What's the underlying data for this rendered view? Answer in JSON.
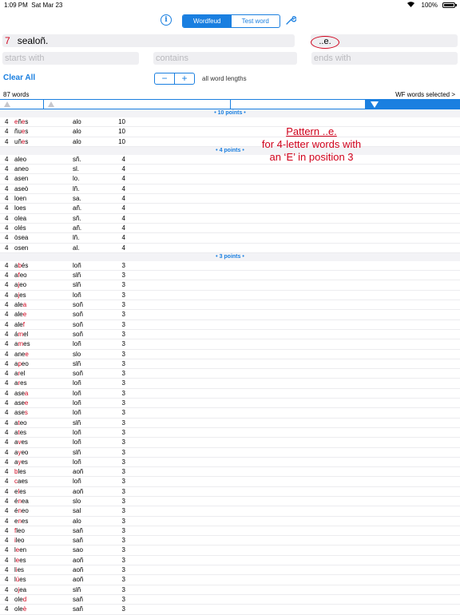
{
  "status": {
    "time": "1:09 PM",
    "date": "Sat Mar 23",
    "battery": "100%"
  },
  "toolbar": {
    "info": "i",
    "segments": [
      "Wordfeud",
      "Test word"
    ],
    "active_segment": 0
  },
  "rack": {
    "count": "7",
    "letters": "sealoñ.",
    "pattern": "..e."
  },
  "filters": {
    "starts_with": "starts with",
    "contains": "contains",
    "ends_with": "ends with"
  },
  "controls": {
    "clear_all": "Clear All",
    "minus": "−",
    "plus": "+",
    "word_lengths": "all word lengths"
  },
  "summary": {
    "count": "87 words",
    "selected": "WF words selected >"
  },
  "annotation": {
    "line1": "Pattern ..e.",
    "line2": "for 4-letter words with",
    "line3": "an ‘E’ in position 3"
  },
  "sections": [
    {
      "label": "• 10 points •",
      "rows": [
        {
          "len": "4",
          "w": [
            [
              "e",
              "h"
            ],
            [
              "ñ",
              ""
            ],
            [
              "e",
              "h"
            ],
            [
              "s",
              ""
            ]
          ],
          "rack": "alo",
          "pts": "10"
        },
        {
          "len": "4",
          "w": [
            [
              "ñ",
              ""
            ],
            [
              "u",
              ""
            ],
            [
              "e",
              "h"
            ],
            [
              "s",
              ""
            ]
          ],
          "rack": "alo",
          "pts": "10"
        },
        {
          "len": "4",
          "w": [
            [
              "u",
              ""
            ],
            [
              "ñ",
              ""
            ],
            [
              "e",
              "h"
            ],
            [
              "s",
              ""
            ]
          ],
          "rack": "alo",
          "pts": "10"
        }
      ]
    },
    {
      "label": "• 4 points •",
      "rows": [
        {
          "len": "4",
          "w": [
            [
              "aleo",
              ""
            ]
          ],
          "rack": "sñ.",
          "pts": "4"
        },
        {
          "len": "4",
          "w": [
            [
              "aneo",
              ""
            ]
          ],
          "rack": "sl.",
          "pts": "4"
        },
        {
          "len": "4",
          "w": [
            [
              "asen",
              ""
            ]
          ],
          "rack": "lo.",
          "pts": "4"
        },
        {
          "len": "4",
          "w": [
            [
              "aseò",
              ""
            ]
          ],
          "rack": "lñ.",
          "pts": "4"
        },
        {
          "len": "4",
          "w": [
            [
              "loen",
              ""
            ]
          ],
          "rack": "sa.",
          "pts": "4"
        },
        {
          "len": "4",
          "w": [
            [
              "loes",
              ""
            ]
          ],
          "rack": "añ.",
          "pts": "4"
        },
        {
          "len": "4",
          "w": [
            [
              "olea",
              ""
            ]
          ],
          "rack": "sñ.",
          "pts": "4"
        },
        {
          "len": "4",
          "w": [
            [
              "olés",
              ""
            ]
          ],
          "rack": "añ.",
          "pts": "4"
        },
        {
          "len": "4",
          "w": [
            [
              "òsea",
              ""
            ]
          ],
          "rack": "lñ.",
          "pts": "4"
        },
        {
          "len": "4",
          "w": [
            [
              "osen",
              ""
            ]
          ],
          "rack": "al.",
          "pts": "4"
        }
      ]
    },
    {
      "label": "• 3 points •",
      "rows": [
        {
          "len": "4",
          "w": [
            [
              "a",
              ""
            ],
            [
              "b",
              "h"
            ],
            [
              "és",
              ""
            ]
          ],
          "rack": "loñ",
          "pts": "3"
        },
        {
          "len": "4",
          "w": [
            [
              "a",
              ""
            ],
            [
              "f",
              "h"
            ],
            [
              "eo",
              ""
            ]
          ],
          "rack": "slñ",
          "pts": "3"
        },
        {
          "len": "4",
          "w": [
            [
              "a",
              ""
            ],
            [
              "j",
              "h"
            ],
            [
              "eo",
              ""
            ]
          ],
          "rack": "slñ",
          "pts": "3"
        },
        {
          "len": "4",
          "w": [
            [
              "a",
              ""
            ],
            [
              "j",
              "h"
            ],
            [
              "es",
              ""
            ]
          ],
          "rack": "loñ",
          "pts": "3"
        },
        {
          "len": "4",
          "w": [
            [
              "ale",
              ""
            ],
            [
              "a",
              "h"
            ]
          ],
          "rack": "soñ",
          "pts": "3"
        },
        {
          "len": "4",
          "w": [
            [
              "ale",
              ""
            ],
            [
              "e",
              "h"
            ]
          ],
          "rack": "soñ",
          "pts": "3"
        },
        {
          "len": "4",
          "w": [
            [
              "ale",
              ""
            ],
            [
              "f",
              "h"
            ]
          ],
          "rack": "soñ",
          "pts": "3"
        },
        {
          "len": "4",
          "w": [
            [
              "á",
              ""
            ],
            [
              "m",
              "h"
            ],
            [
              "el",
              ""
            ]
          ],
          "rack": "soñ",
          "pts": "3"
        },
        {
          "len": "4",
          "w": [
            [
              "a",
              ""
            ],
            [
              "m",
              "h"
            ],
            [
              "es",
              ""
            ]
          ],
          "rack": "loñ",
          "pts": "3"
        },
        {
          "len": "4",
          "w": [
            [
              "ane",
              ""
            ],
            [
              "e",
              "h"
            ]
          ],
          "rack": "slo",
          "pts": "3"
        },
        {
          "len": "4",
          "w": [
            [
              "a",
              ""
            ],
            [
              "p",
              "h"
            ],
            [
              "eo",
              ""
            ]
          ],
          "rack": "slñ",
          "pts": "3"
        },
        {
          "len": "4",
          "w": [
            [
              "a",
              ""
            ],
            [
              "r",
              "h"
            ],
            [
              "el",
              ""
            ]
          ],
          "rack": "soñ",
          "pts": "3"
        },
        {
          "len": "4",
          "w": [
            [
              "a",
              ""
            ],
            [
              "r",
              "h"
            ],
            [
              "es",
              ""
            ]
          ],
          "rack": "loñ",
          "pts": "3"
        },
        {
          "len": "4",
          "w": [
            [
              "ase",
              ""
            ],
            [
              "a",
              "h"
            ]
          ],
          "rack": "loñ",
          "pts": "3"
        },
        {
          "len": "4",
          "w": [
            [
              "ase",
              ""
            ],
            [
              "e",
              "h"
            ]
          ],
          "rack": "loñ",
          "pts": "3"
        },
        {
          "len": "4",
          "w": [
            [
              "ase",
              ""
            ],
            [
              "s",
              "h"
            ]
          ],
          "rack": "loñ",
          "pts": "3"
        },
        {
          "len": "4",
          "w": [
            [
              "a",
              ""
            ],
            [
              "t",
              "h"
            ],
            [
              "eo",
              ""
            ]
          ],
          "rack": "slñ",
          "pts": "3"
        },
        {
          "len": "4",
          "w": [
            [
              "a",
              ""
            ],
            [
              "t",
              "h"
            ],
            [
              "es",
              ""
            ]
          ],
          "rack": "loñ",
          "pts": "3"
        },
        {
          "len": "4",
          "w": [
            [
              "a",
              ""
            ],
            [
              "v",
              "h"
            ],
            [
              "es",
              ""
            ]
          ],
          "rack": "loñ",
          "pts": "3"
        },
        {
          "len": "4",
          "w": [
            [
              "a",
              ""
            ],
            [
              "y",
              "h"
            ],
            [
              "eo",
              ""
            ]
          ],
          "rack": "slñ",
          "pts": "3"
        },
        {
          "len": "4",
          "w": [
            [
              "a",
              ""
            ],
            [
              "y",
              "h"
            ],
            [
              "es",
              ""
            ]
          ],
          "rack": "loñ",
          "pts": "3"
        },
        {
          "len": "4",
          "w": [
            [
              "b",
              "h"
            ],
            [
              "les",
              ""
            ]
          ],
          "rack": "aoñ",
          "pts": "3"
        },
        {
          "len": "4",
          "w": [
            [
              "c",
              "h"
            ],
            [
              "aes",
              ""
            ]
          ],
          "rack": "loñ",
          "pts": "3"
        },
        {
          "len": "4",
          "w": [
            [
              "e",
              ""
            ],
            [
              "l",
              "h"
            ],
            [
              "es",
              ""
            ]
          ],
          "rack": "aoñ",
          "pts": "3"
        },
        {
          "len": "4",
          "w": [
            [
              "é",
              ""
            ],
            [
              "n",
              "h"
            ],
            [
              "ea",
              ""
            ]
          ],
          "rack": "slo",
          "pts": "3"
        },
        {
          "len": "4",
          "w": [
            [
              "é",
              ""
            ],
            [
              "n",
              "h"
            ],
            [
              "eo",
              ""
            ]
          ],
          "rack": "sal",
          "pts": "3"
        },
        {
          "len": "4",
          "w": [
            [
              "e",
              ""
            ],
            [
              "n",
              "h"
            ],
            [
              "es",
              ""
            ]
          ],
          "rack": "alo",
          "pts": "3"
        },
        {
          "len": "4",
          "w": [
            [
              "f",
              "h"
            ],
            [
              "leo",
              ""
            ]
          ],
          "rack": "sañ",
          "pts": "3"
        },
        {
          "len": "4",
          "w": [
            [
              "i",
              "h"
            ],
            [
              "leo",
              ""
            ]
          ],
          "rack": "sañ",
          "pts": "3"
        },
        {
          "len": "4",
          "w": [
            [
              "l",
              ""
            ],
            [
              "e",
              "h"
            ],
            [
              "en",
              ""
            ]
          ],
          "rack": "sao",
          "pts": "3"
        },
        {
          "len": "4",
          "w": [
            [
              "l",
              ""
            ],
            [
              "e",
              "h"
            ],
            [
              "es",
              ""
            ]
          ],
          "rack": "aoñ",
          "pts": "3"
        },
        {
          "len": "4",
          "w": [
            [
              "l",
              ""
            ],
            [
              "i",
              "h"
            ],
            [
              "es",
              ""
            ]
          ],
          "rack": "aoñ",
          "pts": "3"
        },
        {
          "len": "4",
          "w": [
            [
              "l",
              ""
            ],
            [
              "ú",
              "h"
            ],
            [
              "es",
              ""
            ]
          ],
          "rack": "aoñ",
          "pts": "3"
        },
        {
          "len": "4",
          "w": [
            [
              "o",
              ""
            ],
            [
              "j",
              "h"
            ],
            [
              "ea",
              ""
            ]
          ],
          "rack": "slñ",
          "pts": "3"
        },
        {
          "len": "4",
          "w": [
            [
              "ole",
              ""
            ],
            [
              "d",
              "h"
            ]
          ],
          "rack": "sañ",
          "pts": "3"
        },
        {
          "len": "4",
          "w": [
            [
              "ole",
              ""
            ],
            [
              "è",
              "h"
            ]
          ],
          "rack": "sañ",
          "pts": "3"
        }
      ]
    }
  ],
  "colors": {
    "accent": "#1a7fe0",
    "highlight": "#d0011b"
  },
  "icons": {
    "wrench": "wrench-icon",
    "info": "info-icon",
    "wifi": "wifi-icon",
    "battery": "battery-icon"
  }
}
